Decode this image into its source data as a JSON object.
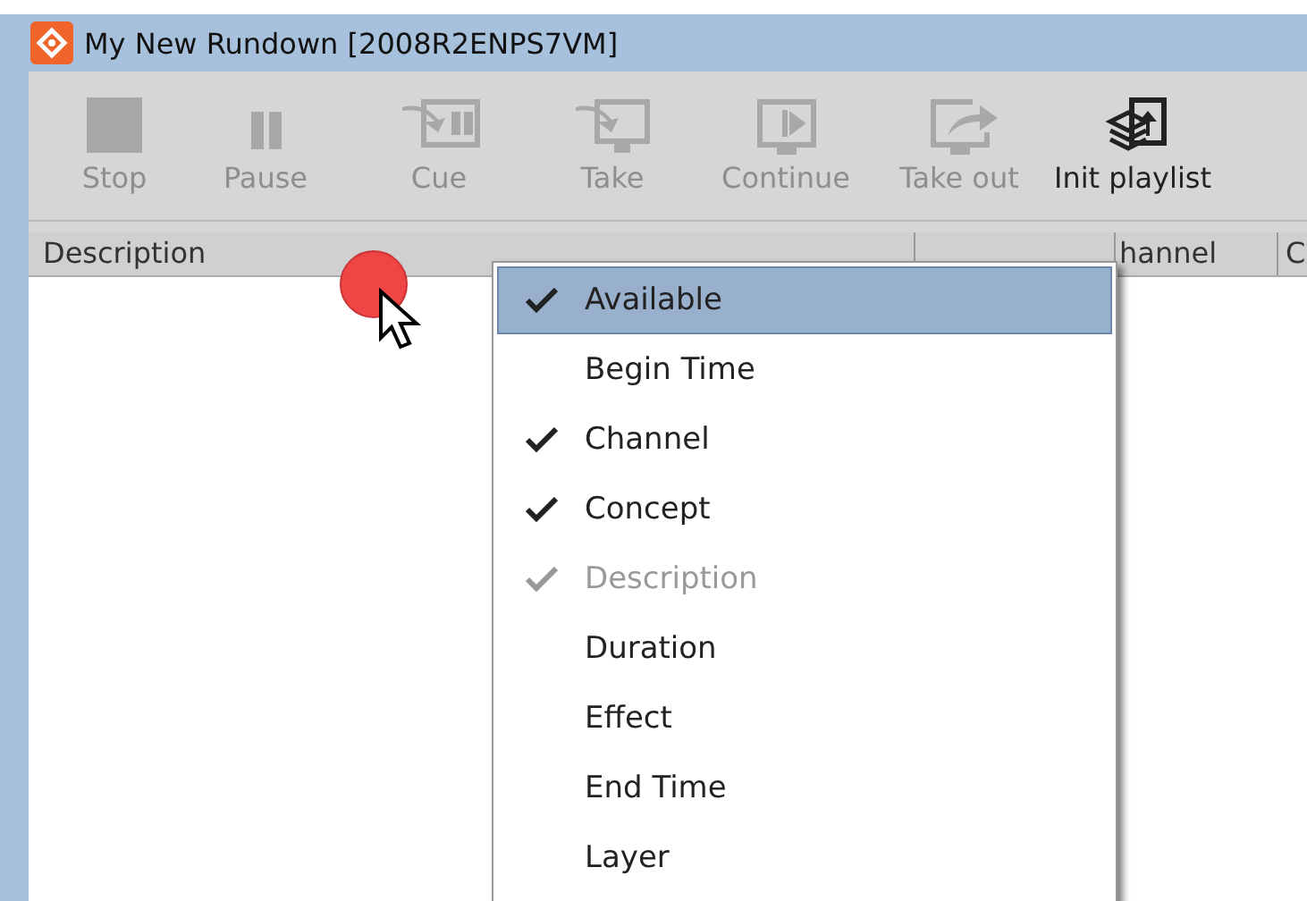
{
  "window": {
    "title": "My New Rundown [2008R2ENPS7VM]"
  },
  "toolbar": [
    {
      "label": "Stop",
      "kind": "stop",
      "disabled": true
    },
    {
      "label": "Pause",
      "kind": "pause",
      "disabled": true
    },
    {
      "label": "Cue",
      "kind": "cue",
      "disabled": true
    },
    {
      "label": "Take",
      "kind": "take",
      "disabled": true
    },
    {
      "label": "Continue",
      "kind": "continue",
      "disabled": true
    },
    {
      "label": "Take out",
      "kind": "takeout",
      "disabled": true
    },
    {
      "label": "Init playlist",
      "kind": "init",
      "disabled": false
    }
  ],
  "columns": [
    "Description",
    "",
    "hannel",
    "C"
  ],
  "menu": [
    {
      "label": "Available",
      "checked": true,
      "disabled": false,
      "selected": true
    },
    {
      "label": "Begin Time",
      "checked": false,
      "disabled": false,
      "selected": false
    },
    {
      "label": "Channel",
      "checked": true,
      "disabled": false,
      "selected": false
    },
    {
      "label": "Concept",
      "checked": true,
      "disabled": false,
      "selected": false
    },
    {
      "label": "Description",
      "checked": true,
      "disabled": true,
      "selected": false
    },
    {
      "label": "Duration",
      "checked": false,
      "disabled": false,
      "selected": false
    },
    {
      "label": "Effect",
      "checked": false,
      "disabled": false,
      "selected": false
    },
    {
      "label": "End Time",
      "checked": false,
      "disabled": false,
      "selected": false
    },
    {
      "label": "Layer",
      "checked": false,
      "disabled": false,
      "selected": false
    }
  ]
}
